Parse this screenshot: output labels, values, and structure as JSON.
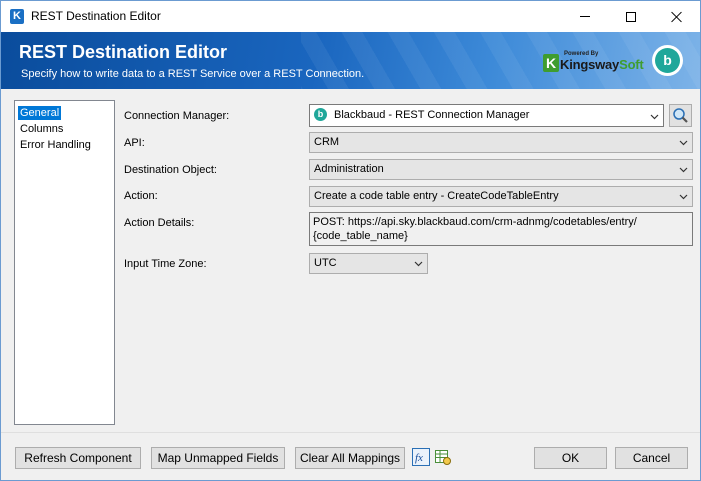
{
  "window": {
    "title": "REST Destination Editor",
    "app_icon_letter": "K"
  },
  "banner": {
    "title": "REST Destination Editor",
    "subtitle": "Specify how to write data to a REST Service over a REST Connection.",
    "vendor_powered_by": "Powered By",
    "vendor_name_main": "Kingsway",
    "vendor_name_accent": "Soft",
    "vendor_logo_letter": "K",
    "partner_logo_letter": "b"
  },
  "nav": {
    "items": [
      {
        "label": "General",
        "selected": true
      },
      {
        "label": "Columns",
        "selected": false
      },
      {
        "label": "Error Handling",
        "selected": false
      }
    ]
  },
  "form": {
    "connection_manager": {
      "label": "Connection Manager:",
      "value": "Blackbaud - REST Connection Manager"
    },
    "api": {
      "label": "API:",
      "value": "CRM"
    },
    "destination_object": {
      "label": "Destination Object:",
      "value": "Administration"
    },
    "action": {
      "label": "Action:",
      "value": "Create a code table entry - CreateCodeTableEntry"
    },
    "action_details": {
      "label": "Action Details:",
      "line1": "POST: https://api.sky.blackbaud.com/crm-adnmg/codetables/entry/",
      "line2": "{code_table_name}"
    },
    "input_time_zone": {
      "label": "Input Time Zone:",
      "value": "UTC"
    }
  },
  "buttons": {
    "refresh": "Refresh Component",
    "map_unmapped": "Map Unmapped Fields",
    "clear_mappings": "Clear All Mappings",
    "fx_label": "fx",
    "ok": "OK",
    "cancel": "Cancel"
  },
  "colors": {
    "selection": "#0078d7",
    "banner_dark": "#0a4c9c",
    "brand_green": "#3f9d2f",
    "blackbaud_teal": "#1fa79a"
  }
}
